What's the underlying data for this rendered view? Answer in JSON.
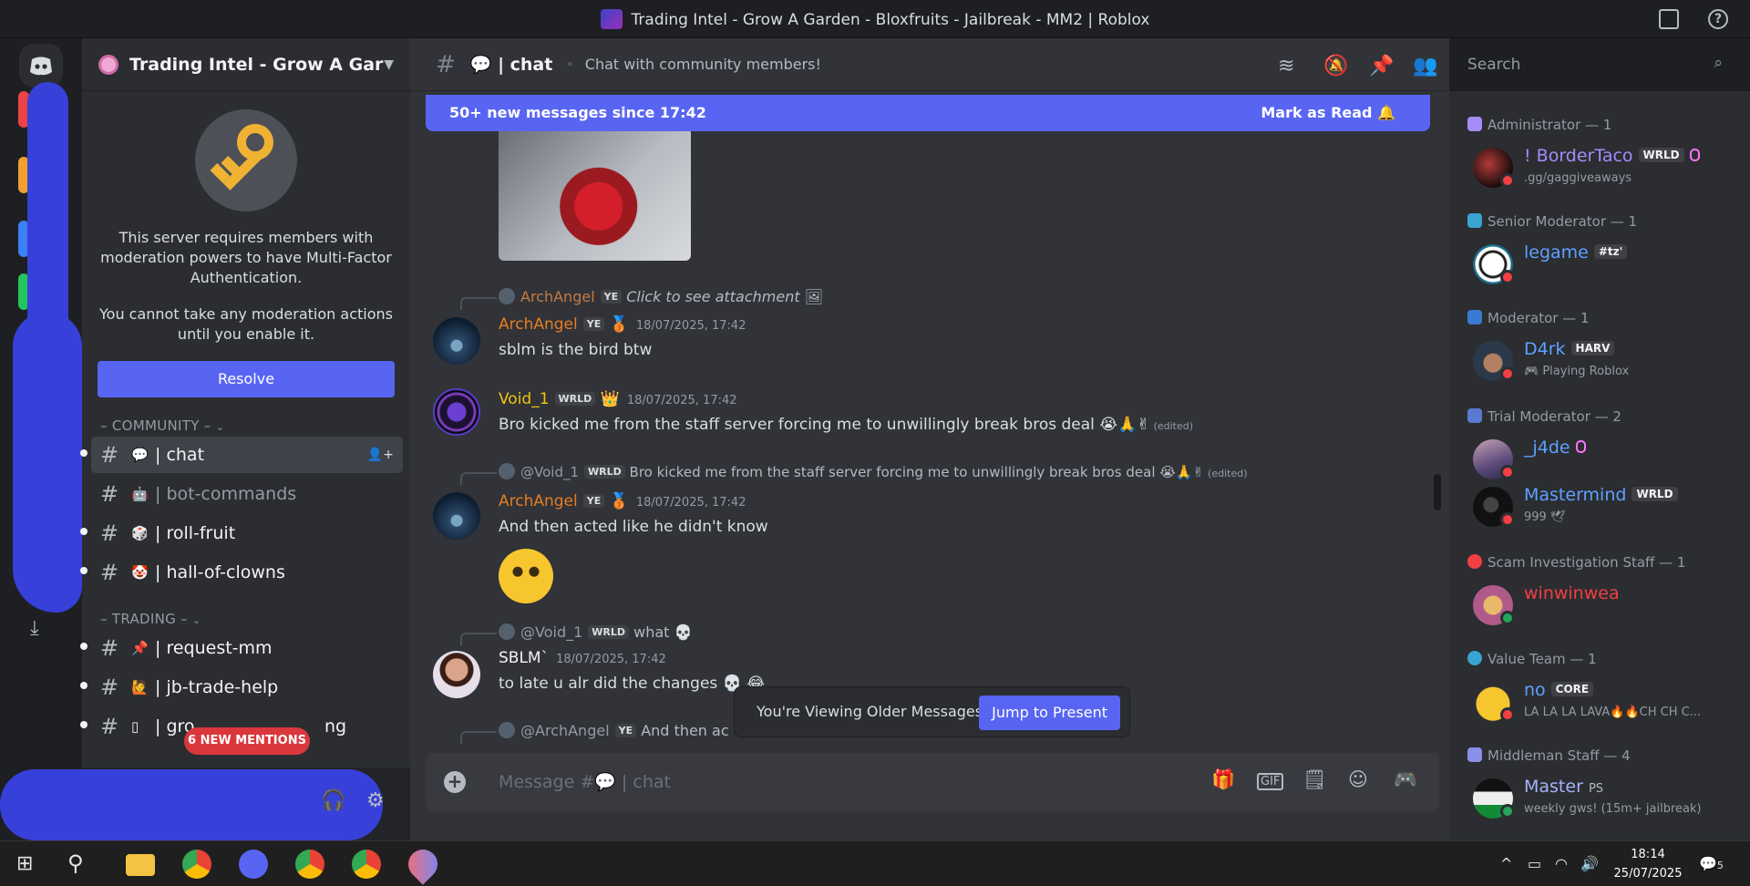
{
  "window": {
    "title": "Trading Intel - Grow A Garden - Bloxfruits - Jailbreak - MM2 | Roblox"
  },
  "server": {
    "name": "Trading Intel - Grow A Garde..."
  },
  "mfa": {
    "line1": "This server requires members with moderation powers to have Multi-Factor Authentication.",
    "line2": "You cannot take any moderation actions until you enable it.",
    "resolve_label": "Resolve"
  },
  "categories": {
    "community": "– COMMUNITY –",
    "trading": "– TRADING –"
  },
  "channels": [
    {
      "emoji": "💬",
      "name": "| chat"
    },
    {
      "emoji": "🤖",
      "name": "| bot-commands"
    },
    {
      "emoji": "🎲",
      "name": "| roll-fruit"
    },
    {
      "emoji": "🤡",
      "name": "| hall-of-clowns"
    },
    {
      "emoji": "📌",
      "name": "| request-mm"
    },
    {
      "emoji": "🙋",
      "name": "| jb-trade-help"
    },
    {
      "emoji": "▯",
      "name": "| gro"
    },
    {
      "emoji": "",
      "name": "ng"
    }
  ],
  "mentions_pill": "6 NEW MENTIONS",
  "header": {
    "channel": "💬 | chat",
    "topic": "Chat with community members!",
    "search_placeholder": "Search"
  },
  "new_messages": {
    "text": "50+ new messages since 17:42",
    "mark_read": "Mark as Read"
  },
  "messages": [
    {
      "reply_user": "ArchAngel",
      "reply_tag": "YE",
      "reply_text": "Click to see attachment",
      "author": "ArchAngel",
      "tag": "YE",
      "time": "18/07/2025, 17:42",
      "text": "sblm is the bird btw"
    },
    {
      "author": "Void_1",
      "tag": "WRLD",
      "time": "18/07/2025, 17:42",
      "text": "Bro kicked me from the staff server forcing me to unwillingly break bros deal 😭🙏✌",
      "edited": "(edited)"
    },
    {
      "reply_user": "@Void_1",
      "reply_tag": "WRLD",
      "reply_text": "Bro kicked me from the staff server forcing me to unwillingly break bros deal 😭🙏✌",
      "reply_edited": "(edited)",
      "author": "ArchAngel",
      "tag": "YE",
      "time": "18/07/2025, 17:42",
      "text": "And then acted like he didn't know"
    },
    {
      "reply_user": "@Void_1",
      "reply_tag": "WRLD",
      "reply_text": "what 💀",
      "author": "SBLM`",
      "time": "18/07/2025, 17:42",
      "text": "to late u alr did the changes 💀 😂"
    },
    {
      "reply_user": "@ArchAngel",
      "reply_tag": "YE",
      "reply_text": "And then ac"
    }
  ],
  "older_banner": {
    "text": "You're Viewing Older Messages",
    "jump": "Jump to Present"
  },
  "composer": {
    "placeholder": "Message #💬 | chat"
  },
  "member_groups": [
    {
      "role": "Administrator — 1",
      "members": [
        {
          "name": "! BorderTaco",
          "tag": "WRLD",
          "sub": ".gg/gaggiveaways"
        }
      ]
    },
    {
      "role": "Senior Moderator — 1",
      "members": [
        {
          "name": "legame",
          "tag": "#tz'",
          "sub": ""
        }
      ]
    },
    {
      "role": "Moderator — 1",
      "members": [
        {
          "name": "D4rk",
          "tag": "HARV",
          "sub": "Playing Roblox"
        }
      ]
    },
    {
      "role": "Trial Moderator — 2",
      "members": [
        {
          "name": "_j4de",
          "tag": "",
          "sub": ""
        },
        {
          "name": "Mastermind",
          "tag": "WRLD",
          "sub": "999 🕊"
        }
      ]
    },
    {
      "role": "Scam Investigation Staff — 1",
      "members": [
        {
          "name": "winwinwea",
          "tag": "",
          "sub": ""
        }
      ]
    },
    {
      "role": "Value Team — 1",
      "members": [
        {
          "name": "no",
          "tag": "CORE",
          "sub": "LA LA LA LAVA🔥🔥CH CH C..."
        }
      ]
    },
    {
      "role": "Middleman Staff — 4",
      "members": [
        {
          "name": "Master",
          "tag": "PS",
          "sub": "weekly gws! (15m+ jailbreak)"
        }
      ]
    }
  ],
  "taskbar": {
    "time": "18:14",
    "date": "25/07/2025",
    "notif_count": "5"
  },
  "colors": {
    "accent": "#5865f2",
    "archangel": "#e67e22",
    "void": "#f1c40f",
    "admin": "#a78bfa",
    "mod": "#5ea0ff",
    "scam": "#f23f43",
    "scribble": "#3740d8"
  }
}
